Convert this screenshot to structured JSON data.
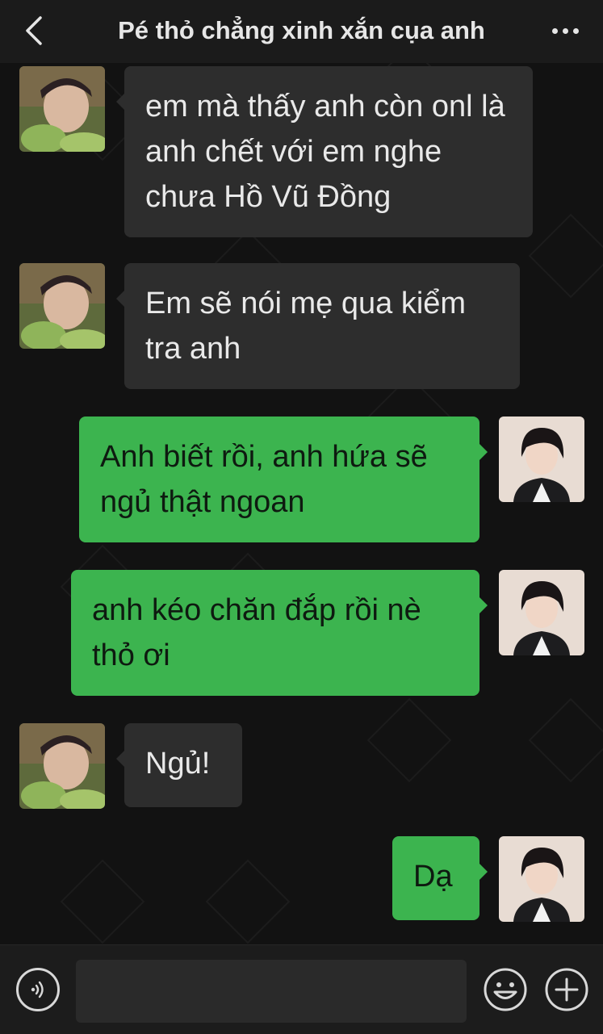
{
  "header": {
    "title": "Pé thỏ chẳng xinh xắn cụa anh",
    "back_icon": "chevron-left-icon",
    "more_icon": "ellipsis-icon"
  },
  "messages": [
    {
      "side": "in",
      "text": "em mà thấy anh còn onl là anh chết với em nghe chưa Hồ Vũ Đồng"
    },
    {
      "side": "in",
      "text": "Em sẽ nói mẹ qua kiểm tra anh"
    },
    {
      "side": "out",
      "text": "Anh biết rồi, anh hứa sẽ ngủ thật ngoan"
    },
    {
      "side": "out",
      "text": "anh kéo chăn đắp rồi nè thỏ ơi"
    },
    {
      "side": "in",
      "text": "Ngủ!"
    },
    {
      "side": "out",
      "text": "Dạ"
    }
  ],
  "input_bar": {
    "placeholder": "",
    "voice_icon": "voice-icon",
    "emoji_icon": "emoji-icon",
    "plus_icon": "plus-icon"
  },
  "colors": {
    "background": "#121212",
    "incoming_bubble": "#2d2d2d",
    "outgoing_bubble": "#3cb44f",
    "header": "#1b1b1b"
  }
}
